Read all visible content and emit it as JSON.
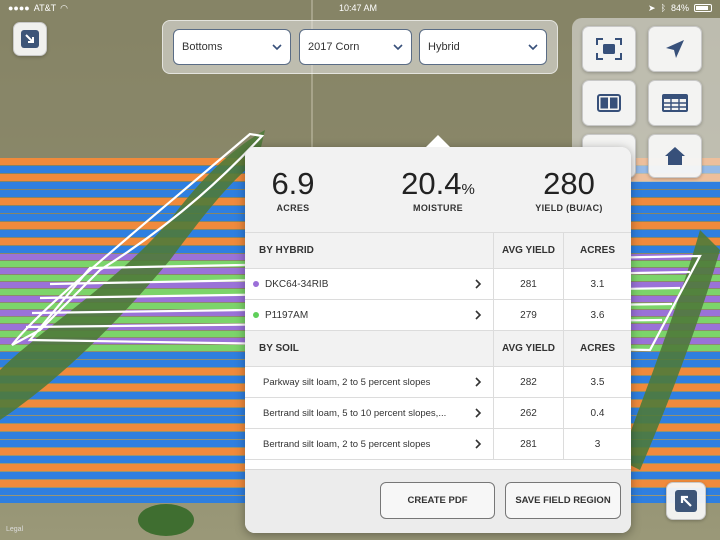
{
  "status_bar": {
    "carrier": "AT&T",
    "time": "10:47 AM",
    "battery": "84%",
    "battery_level": 0.84
  },
  "filters": {
    "field": "Bottoms",
    "season": "2017 Corn",
    "layer": "Hybrid"
  },
  "summary": {
    "acres_value": "6.9",
    "acres_label": "ACRES",
    "moisture_value": "20.4",
    "moisture_unit": "%",
    "moisture_label": "MOISTURE",
    "yield_value": "280",
    "yield_label": "YIELD (BU/AC)"
  },
  "hybrid_table": {
    "header": "BY HYBRID",
    "col_yield": "AVG YIELD",
    "col_acres": "ACRES",
    "rows": [
      {
        "name": "DKC64-34RIB",
        "avg_yield": "281",
        "acres": "3.1",
        "color": "#9b6fd8"
      },
      {
        "name": "P1197AM",
        "avg_yield": "279",
        "acres": "3.6",
        "color": "#5fcf5a"
      }
    ]
  },
  "soil_table": {
    "header": "BY SOIL",
    "col_yield": "AVG YIELD",
    "col_acres": "ACRES",
    "rows": [
      {
        "name": "Parkway silt loam, 2 to 5 percent slopes",
        "avg_yield": "282",
        "acres": "3.5"
      },
      {
        "name": "Bertrand silt loam, 5 to 10 percent slopes,...",
        "avg_yield": "262",
        "acres": "0.4"
      },
      {
        "name": "Bertrand silt loam, 2 to 5 percent slopes",
        "avg_yield": "281",
        "acres": "3"
      }
    ]
  },
  "actions": {
    "create_pdf": "CREATE PDF",
    "save_region": "SAVE FIELD REGION"
  },
  "map": {
    "legal_label": "Legal",
    "colors": {
      "orange": "#f08a3c",
      "blue": "#2f7fe0",
      "purple": "#9a72d8",
      "green": "#7cd46a",
      "accent": "#37507a"
    }
  }
}
